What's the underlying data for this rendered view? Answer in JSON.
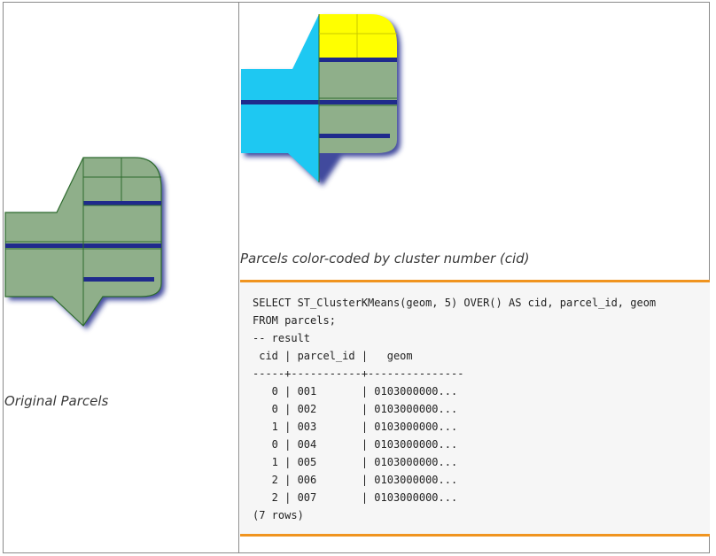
{
  "captions": {
    "original": "Original Parcels",
    "clustered": "Parcels color-coded by cluster number (cid)"
  },
  "colors": {
    "parcel_green": "#8faf8a",
    "parcel_outline": "#2e6b2e",
    "shadow": "#1f2a8c",
    "cluster_cyan": "#1ec8f2",
    "cluster_yellow": "#ffff00",
    "code_border": "#f0941f",
    "code_background": "#f6f6f6"
  },
  "code": {
    "lines": [
      "SELECT ST_ClusterKMeans(geom, 5) OVER() AS cid, parcel_id, geom",
      "FROM parcels;",
      "-- result",
      " cid | parcel_id |   geom",
      "-----+-----------+---------------",
      "   0 | 001       | 0103000000...",
      "   0 | 002       | 0103000000...",
      "   1 | 003       | 0103000000...",
      "   0 | 004       | 0103000000...",
      "   1 | 005       | 0103000000...",
      "   2 | 006       | 0103000000...",
      "   2 | 007       | 0103000000...",
      "(7 rows)"
    ]
  }
}
